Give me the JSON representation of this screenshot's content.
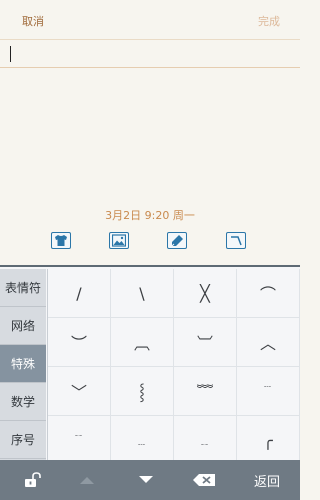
{
  "header": {
    "cancel_label": "取消",
    "done_label": "完成"
  },
  "note": {
    "text": "",
    "datetime": "3月2日 9:20 周一"
  },
  "toolbar": {
    "icons": [
      "shirt-icon",
      "image-icon",
      "pen-icon",
      "signature-icon"
    ]
  },
  "keyboard": {
    "categories": [
      "表情符",
      "网络",
      "特殊",
      "数学",
      "序号"
    ],
    "active_category": "特殊",
    "symbols": [
      "/",
      "\\",
      "╳",
      "⌒",
      "︶",
      "︹",
      "︺",
      "︿",
      "﹀",
      "⸾",
      "﹌",
      "﹉",
      "﹊",
      "﹍",
      "﹎",
      "╭"
    ]
  },
  "bottom_bar": {
    "back_label": "返回",
    "icons": [
      "lock-open-icon",
      "arrow-up-icon",
      "arrow-down-icon",
      "backspace-icon"
    ]
  },
  "colors": {
    "accent": "#c98a4e",
    "icon_blue": "#2b76a8",
    "keyboard_bar": "#6f7a84",
    "active_category": "#8593a0"
  }
}
